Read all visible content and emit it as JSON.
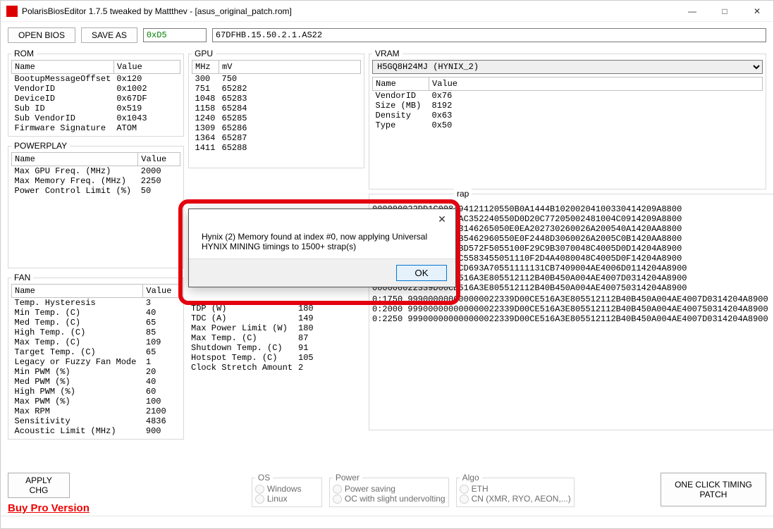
{
  "window": {
    "title": "PolarisBiosEditor 1.7.5 tweaked by Mattthev  - [asus_original_patch.rom]"
  },
  "toolbar": {
    "open_label": "OPEN BIOS",
    "save_label": "SAVE AS",
    "hex_box": "0xD5",
    "info_box": "67DFHB.15.50.2.1.AS22"
  },
  "rom": {
    "legend": "ROM",
    "col_name": "Name",
    "col_value": "Value",
    "rows": [
      {
        "n": "BootupMessageOffset",
        "v": "0x120"
      },
      {
        "n": "VendorID",
        "v": "0x1002"
      },
      {
        "n": "DeviceID",
        "v": "0x67DF"
      },
      {
        "n": "Sub ID",
        "v": "0x519"
      },
      {
        "n": "Sub VendorID",
        "v": "0x1043"
      },
      {
        "n": "Firmware Signature",
        "v": "ATOM"
      }
    ]
  },
  "powerplay": {
    "legend": "POWERPLAY",
    "col_name": "Name",
    "col_value": "Value",
    "rows": [
      {
        "n": "Max GPU Freq. (MHz)",
        "v": "2000"
      },
      {
        "n": "Max Memory Freq. (MHz)",
        "v": "2250"
      },
      {
        "n": "Power Control Limit (%)",
        "v": "50"
      }
    ]
  },
  "fan": {
    "legend": "FAN",
    "col_name": "Name",
    "col_value": "Value",
    "rows": [
      {
        "n": "Temp. Hysteresis",
        "v": "3"
      },
      {
        "n": "Min Temp. (C)",
        "v": "40"
      },
      {
        "n": "Med Temp. (C)",
        "v": "65"
      },
      {
        "n": "High Temp. (C)",
        "v": "85"
      },
      {
        "n": "Max Temp. (C)",
        "v": "109"
      },
      {
        "n": "Target Temp. (C)",
        "v": "65"
      },
      {
        "n": "Legacy or Fuzzy Fan Mode",
        "v": "1"
      },
      {
        "n": "Min PWM (%)",
        "v": "20"
      },
      {
        "n": "Med PWM (%)",
        "v": "40"
      },
      {
        "n": "High PWM (%)",
        "v": "60"
      },
      {
        "n": "Max PWM (%)",
        "v": "100"
      },
      {
        "n": "Max RPM",
        "v": "2100"
      },
      {
        "n": "Sensitivity",
        "v": "4836"
      },
      {
        "n": "Acoustic Limit (MHz)",
        "v": "900"
      }
    ]
  },
  "gpu": {
    "legend": "GPU",
    "col_mhz": "MHz",
    "col_mv": "mV",
    "rows": [
      {
        "mhz": "300",
        "mv": "750"
      },
      {
        "mhz": "751",
        "mv": "65282"
      },
      {
        "mhz": "1048",
        "mv": "65283"
      },
      {
        "mhz": "1158",
        "mv": "65284"
      },
      {
        "mhz": "1240",
        "mv": "65285"
      },
      {
        "mhz": "1309",
        "mv": "65286"
      },
      {
        "mhz": "1364",
        "mv": "65287"
      },
      {
        "mhz": "1411",
        "mv": "65288"
      }
    ]
  },
  "powertune_extra": {
    "rows": [
      {
        "n": "TDP (W)",
        "v": "180"
      },
      {
        "n": "TDC (A)",
        "v": "149"
      },
      {
        "n": "Max Power Limit (W)",
        "v": "180"
      },
      {
        "n": "Max Temp. (C)",
        "v": "87"
      },
      {
        "n": "Shutdown Temp. (C)",
        "v": "91"
      },
      {
        "n": "Hotspot Temp. (C)",
        "v": "105"
      },
      {
        "n": "Clock Stretch Amount",
        "v": "2"
      }
    ]
  },
  "vram": {
    "legend": "VRAM",
    "selected": "H5GQ8H24MJ (HYNIX_2)",
    "col_name": "Name",
    "col_value": "Value",
    "rows": [
      {
        "n": "VendorID",
        "v": "0x76"
      },
      {
        "n": "Size (MB)",
        "v": "8192"
      },
      {
        "n": "Density",
        "v": "0x63"
      },
      {
        "n": "Type",
        "v": "0x50"
      }
    ]
  },
  "straps": {
    "header_right": "rap",
    "lines_right": [
      "000000022DD1C008494121120550B0A1444B10200204100330414209A8800",
      "000000022DD1C00E7AC352240550D0D20C77205002481004C0914209A8800",
      "000000022DD1C00293146265050E0EA202730260026A200540A1420AA8800",
      "000000022DD1C0029B5462960550E0F2448D3060026A2005C0B1420AA8800",
      "000000022339D006BBD572F5055100F29C9B3070048C4005D0D14204A8900",
      "000000022339D008CC5583455051110F2D4A4080048C4005D0F14204A8900",
      "000000022339D00ADCD693A70551111131CB7409004AE4006D0114204A8900",
      "000000022339D00CE516A3E805512112B40B450A004AE4007D0314204A8900",
      "000000022339D00CE516A3E805512112B40B450A004AE400750314204A8900"
    ],
    "lines_bottom": [
      "0:1750  999000000000000022339D00CE516A3E805512112B40B450A004AE4007D0314204A8900",
      "0:2000  999000000000000022339D00CE516A3E805512112B40B450A004AE400750314204A8900",
      "0:2250  999000000000000022339D00CE516A3E805512112B40B450A004AE4007D0314204A8900"
    ]
  },
  "bottom": {
    "apply_label": "APPLY CHG",
    "pro_label": "Buy Pro Version",
    "os_legend": "OS",
    "os_win": "Windows",
    "os_lin": "Linux",
    "power_legend": "Power",
    "pw_save": "Power saving",
    "pw_oc": "OC with slight undervolting",
    "algo_legend": "Algo",
    "algo_eth": "ETH",
    "algo_cn": "CN (XMR, RYO, AEON,...)",
    "big_label": "ONE CLICK TIMING PATCH"
  },
  "dialog": {
    "message": "Hynix (2) Memory found at index #0, now applying Universal HYNIX MINING timings to 1500+ strap(s)",
    "ok_label": "OK"
  }
}
